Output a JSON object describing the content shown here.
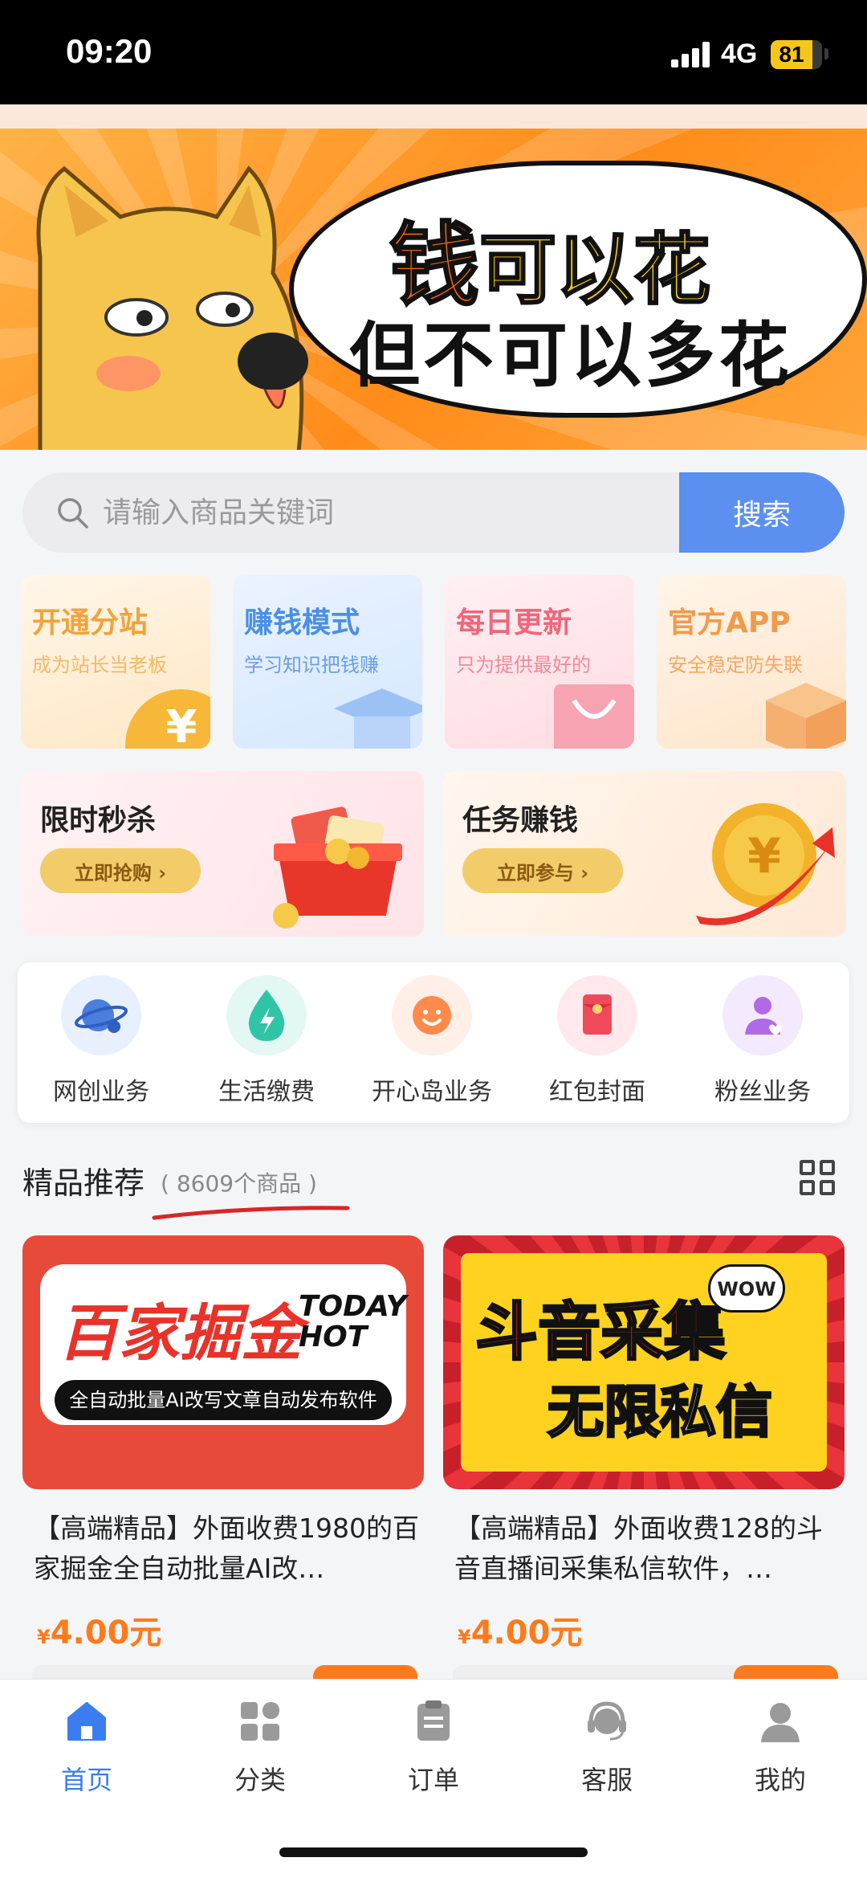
{
  "status_bar": {
    "time": "09:20",
    "network": "4G",
    "battery": "81",
    "battery_level": 0.81
  },
  "banner": {
    "line1_big": "钱",
    "line1_rest": "可以花",
    "line2": "但不可以多花"
  },
  "search": {
    "placeholder": "请输入商品关键词",
    "button_label": "搜索",
    "button_color": "#5b8ff0"
  },
  "features": [
    {
      "title": "开通分站",
      "subtitle": "成为站长当老板",
      "title_color": "#f2a23a",
      "sub_color": "#f5b866",
      "bg": "#fff1dc",
      "icon": "yen-coin-icon"
    },
    {
      "title": "赚钱模式",
      "subtitle": "学习知识把钱赚",
      "title_color": "#4a8fe8",
      "sub_color": "#6a9fe0",
      "bg": "#e3efff",
      "icon": "graduation-cap-icon"
    },
    {
      "title": "每日更新",
      "subtitle": "只为提供最好的",
      "title_color": "#f0667a",
      "sub_color": "#f0899a",
      "bg": "#ffe7ec",
      "icon": "shopping-bag-icon"
    },
    {
      "title": "官方APP",
      "subtitle": "安全稳定防失联",
      "title_color": "#f29a4a",
      "sub_color": "#f5a866",
      "bg": "#fff0e3",
      "icon": "box-icon"
    }
  ],
  "promos": [
    {
      "title": "限时秒杀",
      "button": "立即抢购 ›",
      "icon": "gift-box-icon"
    },
    {
      "title": "任务赚钱",
      "button": "立即参与 ›",
      "icon": "gold-coin-icon"
    }
  ],
  "services": [
    {
      "label": "网创业务",
      "icon": "planet-user-icon",
      "color": "#4a7fe0",
      "bg": "#e9f0fd"
    },
    {
      "label": "生活缴费",
      "icon": "water-drop-icon",
      "color": "#2fc4a6",
      "bg": "#e3f8f3"
    },
    {
      "label": "开心岛业务",
      "icon": "smile-face-icon",
      "color": "#ff8a4a",
      "bg": "#ffefe6"
    },
    {
      "label": "红包封面",
      "icon": "red-envelope-icon",
      "color": "#f04a5a",
      "bg": "#ffe9ec"
    },
    {
      "label": "粉丝业务",
      "icon": "fans-user-icon",
      "color": "#b06ae8",
      "bg": "#f4eafd"
    }
  ],
  "section": {
    "title": "精品推荐",
    "count": "( 8609个商品 )"
  },
  "products": [
    {
      "title": "【高端精品】外面收费1980的百家掘金全自动批量AI改…",
      "price_symbol": "¥",
      "price": "4.00元",
      "image": {
        "headline": "百家掘金",
        "badge_line1": "TODAY",
        "badge_line2": "HOT",
        "caption": "全自动批量AI改写文章自动发布软件"
      }
    },
    {
      "title": "【高端精品】外面收费128的斗音直播间采集私信软件，…",
      "price_symbol": "¥",
      "price": "4.00元",
      "image": {
        "headline": "斗音采集",
        "subline": "无限私信",
        "badge": "WOW"
      }
    }
  ],
  "tabbar": [
    {
      "label": "首页",
      "icon": "home-icon",
      "active": true
    },
    {
      "label": "分类",
      "icon": "category-grid-icon",
      "active": false
    },
    {
      "label": "订单",
      "icon": "clipboard-icon",
      "active": false
    },
    {
      "label": "客服",
      "icon": "headset-icon",
      "active": false
    },
    {
      "label": "我的",
      "icon": "user-icon",
      "active": false
    }
  ],
  "colors": {
    "accent": "#3b7cf0",
    "price": "#ff7a1a"
  }
}
